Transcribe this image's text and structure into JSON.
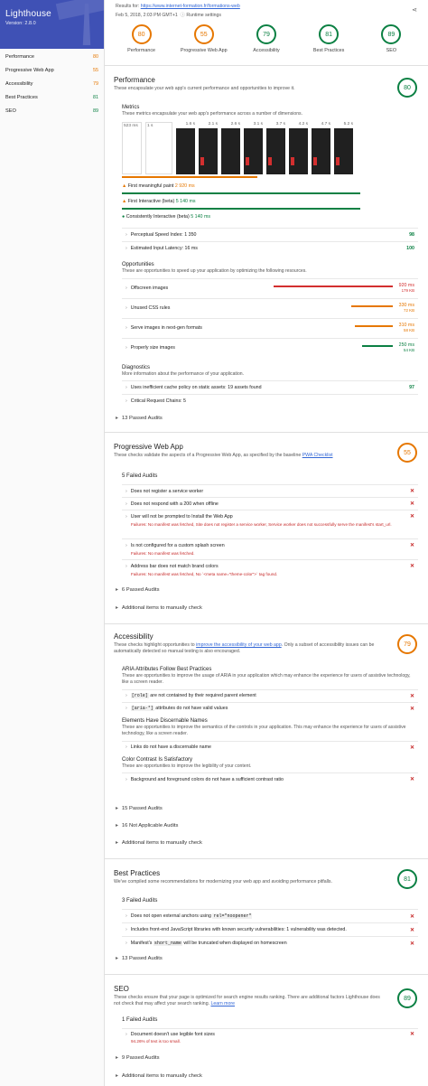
{
  "brand": {
    "title": "Lighthouse",
    "version": "Version: 2.8.0"
  },
  "nav": [
    {
      "label": "Performance",
      "score": "80",
      "color": "#e67700"
    },
    {
      "label": "Progressive Web App",
      "score": "55",
      "color": "#e67700"
    },
    {
      "label": "Accessibility",
      "score": "79",
      "color": "#e67700"
    },
    {
      "label": "Best Practices",
      "score": "81",
      "color": "#0b8043"
    },
    {
      "label": "SEO",
      "score": "89",
      "color": "#0b8043"
    }
  ],
  "top": {
    "results_for": "Results for:",
    "url": "https://www.internet-formation.fr/formations-web",
    "date": "Feb 5, 2018, 2:03 PM GMT+1",
    "runtime": "Runtime settings",
    "share_icon": "share-icon"
  },
  "gauges": [
    {
      "score": "80",
      "label": "Performance"
    },
    {
      "score": "55",
      "label": "Progressive Web App"
    },
    {
      "score": "79",
      "label": "Accessibility"
    },
    {
      "score": "81",
      "label": "Best Practices"
    },
    {
      "score": "89",
      "label": "SEO"
    }
  ],
  "perf": {
    "title": "Performance",
    "score": "80",
    "desc": "These encapsulate your web app's current performance and opportunities to improve it.",
    "metrics_title": "Metrics",
    "metrics_desc": "These metrics encapsulate your web app's performance across a number of dimensions.",
    "film_times": [
      "523 ms",
      "1 s",
      "1.6 s",
      "2.1 s",
      "2.6 s",
      "3.1 s",
      "3.7 s",
      "4.2 s",
      "4.7 s",
      "5.2 s"
    ],
    "fmp_label": "First meaningful paint",
    "fmp_value": "2 920 ms",
    "fi_label": "First Interactive (beta)",
    "fi_value": "5 140 ms",
    "ci_label": "Consistently Interactive (beta)",
    "ci_value": "5 140 ms",
    "psi_label": "Perceptual Speed Index: 1 350",
    "psi_score": "98",
    "eil_label": "Estimated Input Latency: 16 ms",
    "eil_score": "100",
    "opp_title": "Opportunities",
    "opp_desc": "These are opportunities to speed up your application by optimizing the following resources.",
    "opps": [
      {
        "label": "Offscreen images",
        "ms": "920 ms",
        "kb": "179 KB",
        "color": "#d32f2f"
      },
      {
        "label": "Unused CSS rules",
        "ms": "330 ms",
        "kb": "72 KB",
        "color": "#e67700"
      },
      {
        "label": "Serve images in next-gen formats",
        "ms": "310 ms",
        "kb": "58 KB",
        "color": "#e67700"
      },
      {
        "label": "Properly size images",
        "ms": "250 ms",
        "kb": "54 KB",
        "color": "#0b8043"
      }
    ],
    "diag_title": "Diagnostics",
    "diag_desc": "More information about the performance of your application.",
    "diag1": "Uses inefficient cache policy on static assets: 19 assets found",
    "diag1_score": "97",
    "diag2": "Critical Request Chains: 5",
    "passed": "13 Passed Audits"
  },
  "pwa": {
    "title": "Progressive Web App",
    "score": "55",
    "desc_pre": "These checks validate the aspects of a Progressive Web App, as specified by the baseline ",
    "desc_link": "PWA Checklist",
    "failed": "5 Failed Audits",
    "items": [
      {
        "label": "Does not register a service worker",
        "err": ""
      },
      {
        "label": "Does not respond with a 200 when offline",
        "err": ""
      },
      {
        "label": "User will not be prompted to Install the Web App",
        "err": "Failures: No manifest was fetched, Site does not register a service worker, Service worker does not successfully serve the manifest's start_url."
      },
      {
        "label": "Is not configured for a custom splash screen",
        "err": "Failures: No manifest was fetched."
      },
      {
        "label": "Address bar does not match brand colors",
        "err": "Failures: No manifest was fetched, No `<meta name=\"theme-color\">` tag found."
      }
    ],
    "passed": "6 Passed Audits",
    "manual": "Additional items to manually check"
  },
  "a11y": {
    "title": "Accessibility",
    "score": "79",
    "desc_pre": "These checks highlight opportunities to ",
    "desc_link": "improve the accessibility of your web app",
    "desc_post": ". Only a subset of accessibility issues can be automatically detected so manual testing is also encouraged.",
    "g1_title": "ARIA Attributes Follow Best Practices",
    "g1_desc": "These are opportunities to improve the usage of ARIA in your application which may enhance the experience for users of assistive technology, like a screen reader.",
    "g1_i1_code": "[role]",
    "g1_i1": " are not contained by their required parent element",
    "g1_i2_code": "[aria-*]",
    "g1_i2": " attributes do not have valid values",
    "g2_title": "Elements Have Discernable Names",
    "g2_desc": "These are opportunities to improve the semantics of the controls in your application. This may enhance the experience for users of assistive technology, like a screen reader.",
    "g2_i1": "Links do not have a discernable name",
    "g3_title": "Color Contrast Is Satisfactory",
    "g3_desc": "These are opportunities to improve the legibility of your content.",
    "g3_i1": "Background and foreground colors do not have a sufficient contrast ratio",
    "passed": "15 Passed Audits",
    "na": "16 Not Applicable Audits",
    "manual": "Additional items to manually check"
  },
  "bp": {
    "title": "Best Practices",
    "score": "81",
    "desc": "We've compiled some recommendations for modernizing your web app and avoiding performance pitfalls.",
    "failed": "3 Failed Audits",
    "i1_pre": "Does not open external anchors using ",
    "i1_code": "rel=\"noopener\"",
    "i2": "Includes front-end JavaScript libraries with known security vulnerabilities: 1 vulnerability was detected.",
    "i3_pre": "Manifest's ",
    "i3_code": "short_name",
    "i3_post": " will be truncated when displayed on homescreen",
    "passed": "13 Passed Audits"
  },
  "seo": {
    "title": "SEO",
    "score": "89",
    "desc_pre": "These checks ensure that your page is optimized for search engine results ranking. There are additional factors Lighthouse does not check that may affect your search ranking. ",
    "desc_link": "Learn more",
    "failed": "1 Failed Audits",
    "i1": "Document doesn't use legible font sizes",
    "i1_err": "94.26% of text is too small.",
    "passed": "9 Passed Audits",
    "manual": "Additional items to manually check"
  },
  "fail_mark": "✕"
}
